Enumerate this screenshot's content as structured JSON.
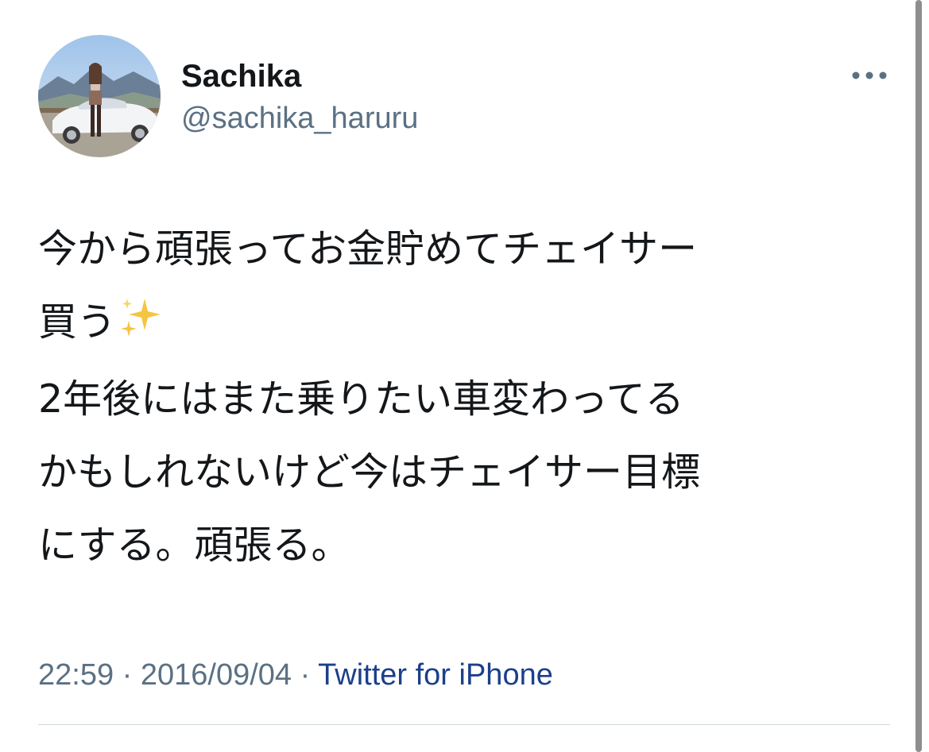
{
  "author": {
    "display_name": "Sachika",
    "handle": "@sachika_haruru",
    "avatar_icon": "profile-photo-woman-with-white-sports-car"
  },
  "more_icon": "more-horizontal-icon",
  "tweet": {
    "paragraph_1": "今から頑張ってお金貯めてチェイサー\n買う",
    "paragraph_1_emoji": "sparkles-emoji",
    "paragraph_2": "2年後にはまた乗りたい車変わってる\nかもしれないけど今はチェイサー目標\nにする。頑張る。"
  },
  "meta": {
    "time": "22:59",
    "separator_1": " · ",
    "date": "2016/09/04",
    "separator_2": " · ",
    "source": "Twitter for iPhone"
  },
  "colors": {
    "text": "#14171a",
    "secondary": "#5b7083",
    "link": "#1b3f8b",
    "divider": "#cfd9de",
    "sparkle": "#f5c542"
  }
}
